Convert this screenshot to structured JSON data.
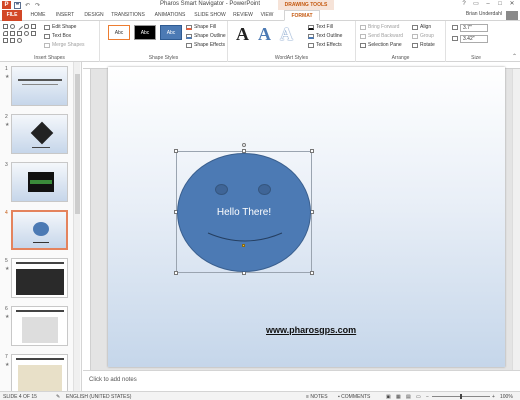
{
  "window": {
    "title": "Pharos Smart Navigator - PowerPoint",
    "context_tab_group": "DRAWING TOOLS",
    "user_name": "Brian Underdahl"
  },
  "qat": {
    "app_icon_letter": "P",
    "save_icon": "save-icon",
    "undo_icon": "undo-icon",
    "redo_icon": "redo-icon"
  },
  "tabs": [
    "FILE",
    "HOME",
    "INSERT",
    "DESIGN",
    "TRANSITIONS",
    "ANIMATIONS",
    "SLIDE SHOW",
    "REVIEW",
    "VIEW",
    "FORMAT"
  ],
  "ribbon": {
    "insert_shapes": {
      "label": "Insert Shapes",
      "edit_shape": "Edit Shape",
      "text_box": "Text Box",
      "merge_shapes": "Merge Shapes"
    },
    "shape_styles": {
      "label": "Shape Styles",
      "swatches": [
        "Abc",
        "Abc",
        "Abc"
      ],
      "shape_fill": "Shape Fill",
      "shape_outline": "Shape Outline",
      "shape_effects": "Shape Effects"
    },
    "wordart_styles": {
      "label": "WordArt Styles",
      "letters": [
        "A",
        "A",
        "A"
      ],
      "text_fill": "Text Fill",
      "text_outline": "Text Outline",
      "text_effects": "Text Effects"
    },
    "arrange": {
      "label": "Arrange",
      "bring_forward": "Bring Forward",
      "send_backward": "Send Backward",
      "selection_pane": "Selection Pane",
      "align": "Align",
      "group": "Group",
      "rotate": "Rotate"
    },
    "size": {
      "label": "Size",
      "height": "3.7\"",
      "width": "3.42\""
    }
  },
  "slides": [
    {
      "number": "1"
    },
    {
      "number": "2"
    },
    {
      "number": "3"
    },
    {
      "number": "4"
    },
    {
      "number": "5"
    },
    {
      "number": "6"
    },
    {
      "number": "7"
    }
  ],
  "slide": {
    "face_text": "Hello There!",
    "website": "www.pharosgps.com"
  },
  "notes": {
    "placeholder": "Click to add notes"
  },
  "status": {
    "slide_count": "SLIDE 4 OF 15",
    "language": "ENGLISH (UNITED STATES)",
    "notes": "NOTES",
    "comments": "COMMENTS",
    "zoom": "100%"
  },
  "colors": {
    "accent": "#d24726",
    "format_tab": "#c55a11",
    "face_fill": "#4c7ab4",
    "selected_thumb_border": "#e4835d"
  }
}
